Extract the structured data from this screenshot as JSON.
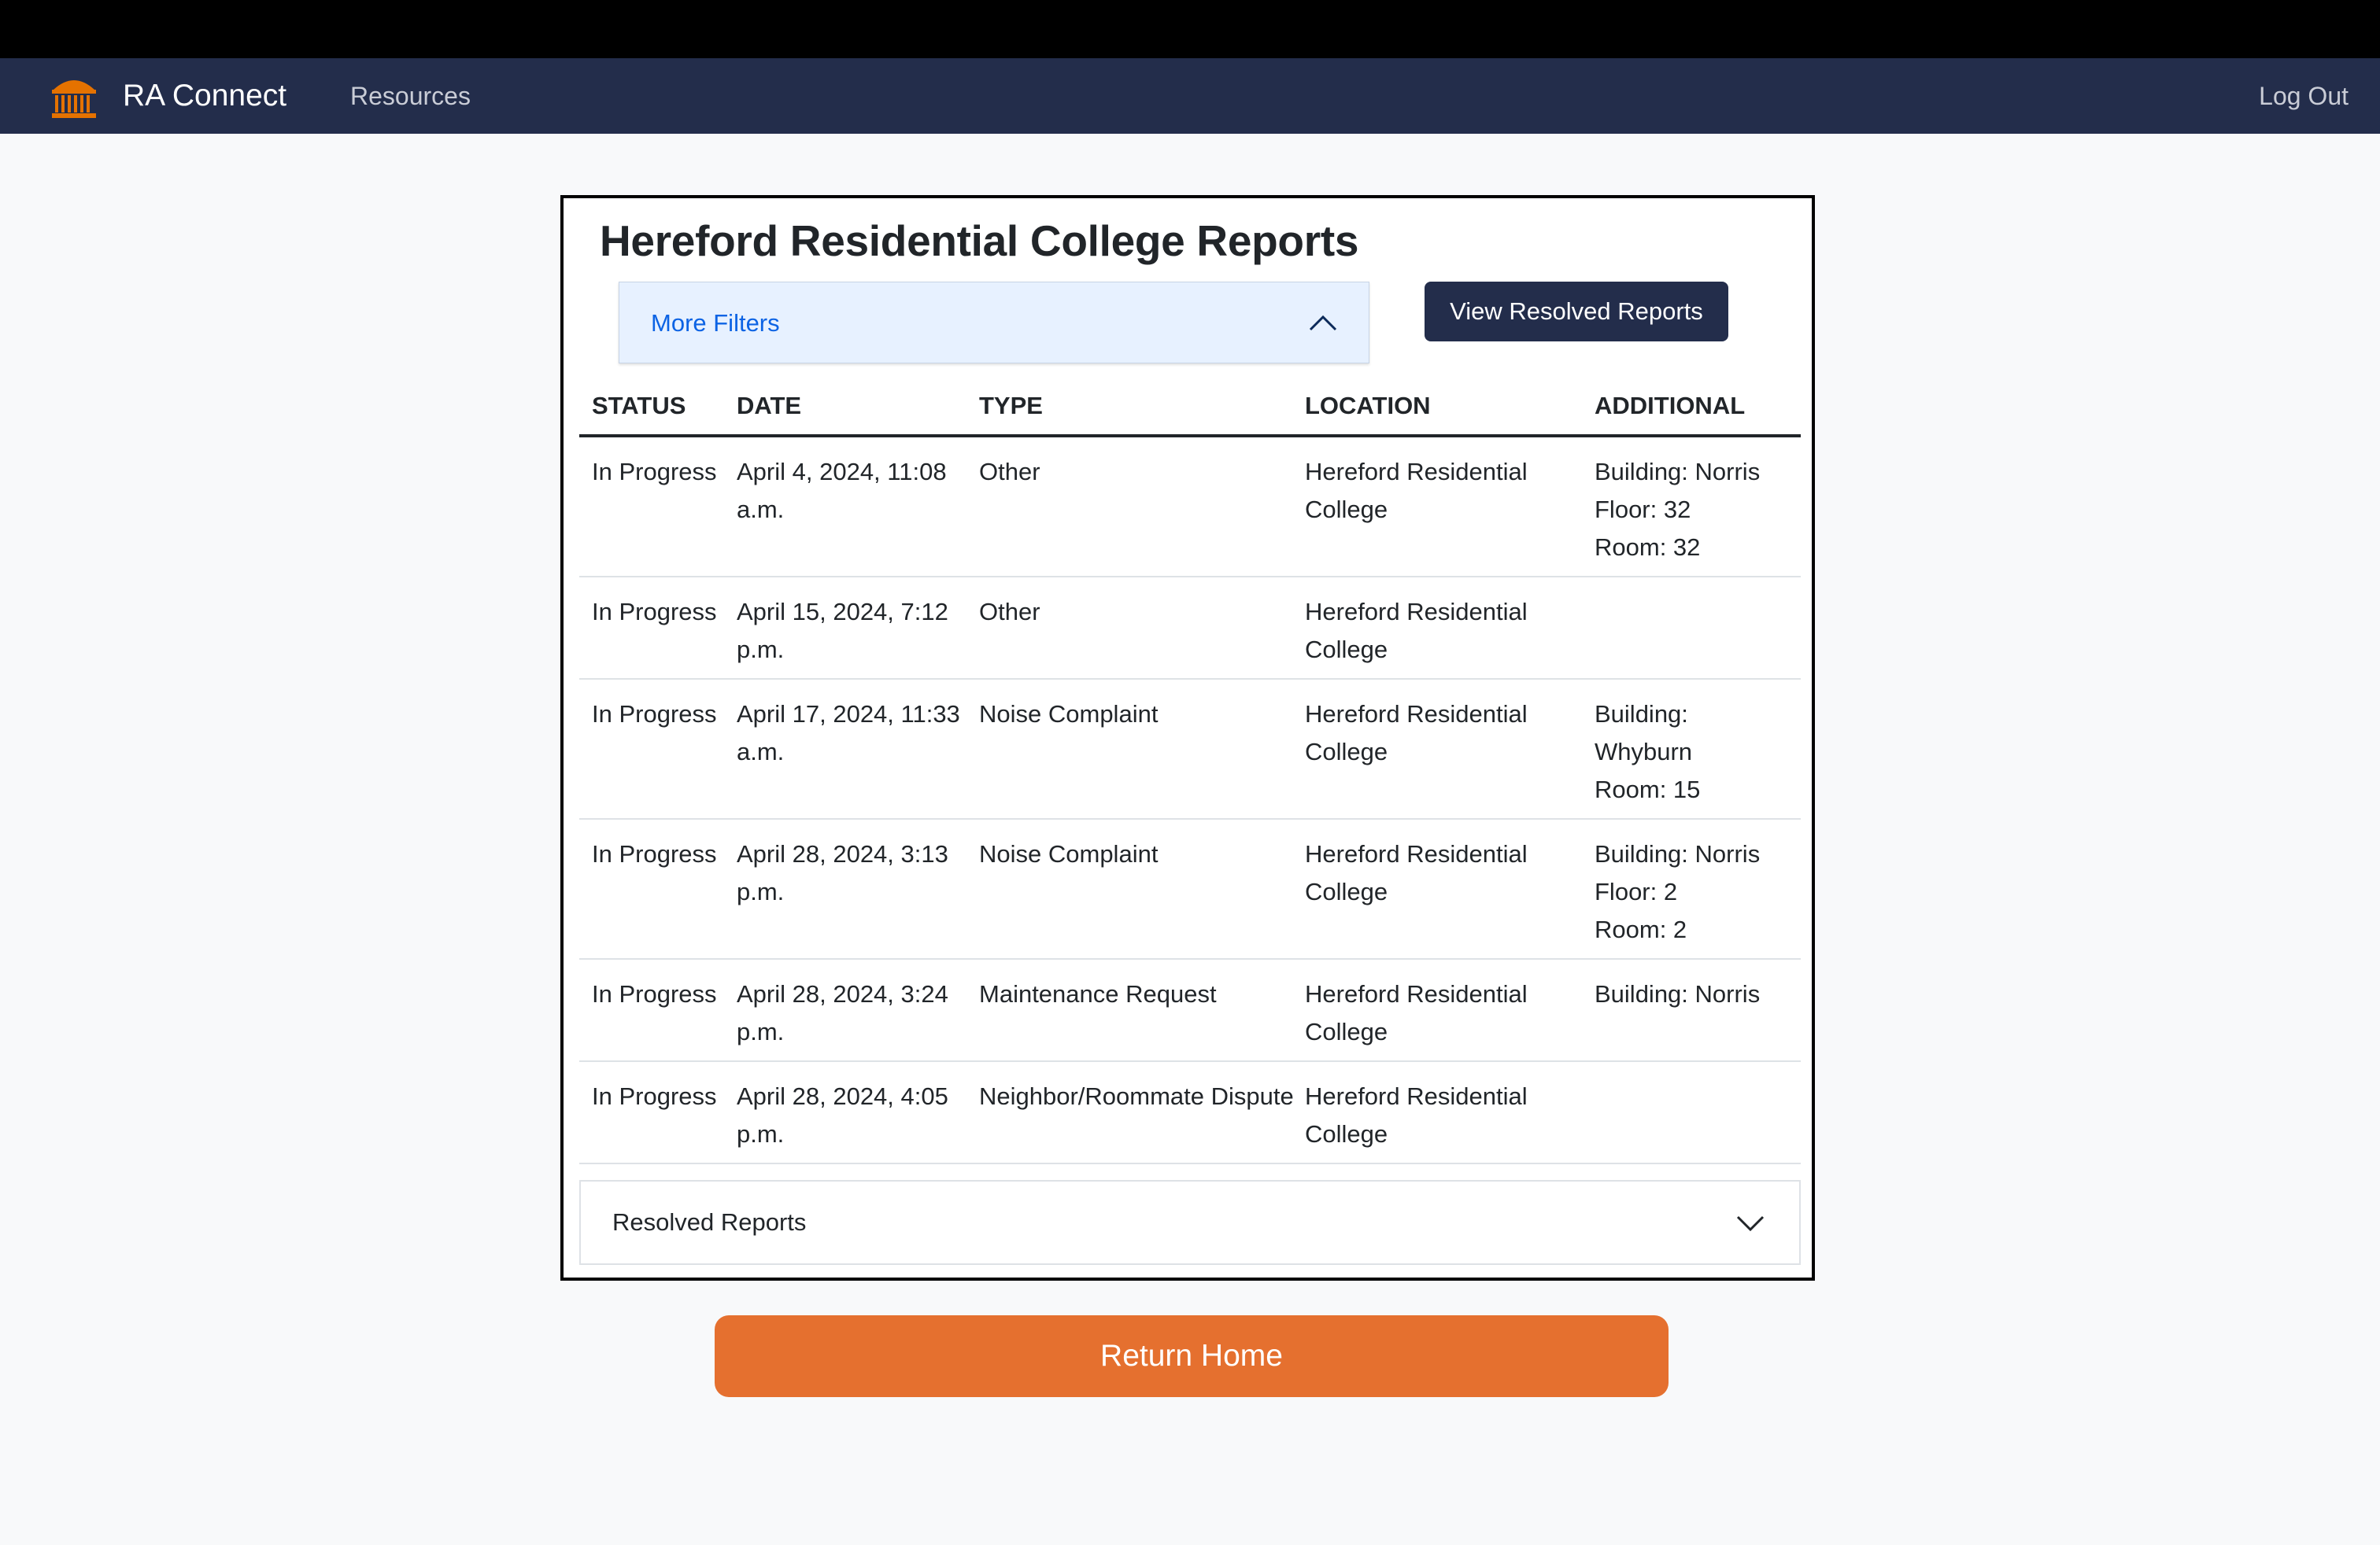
{
  "nav": {
    "brand": "RA Connect",
    "links": [
      "Resources"
    ],
    "logout": "Log Out",
    "brand_color": "#e57200",
    "bar_color": "#232d4b"
  },
  "reports": {
    "title": "Hereford Residential College Reports",
    "filters_label": "More Filters",
    "view_resolved_label": "View Resolved Reports",
    "columns": [
      "STATUS",
      "DATE",
      "TYPE",
      "LOCATION",
      "ADDITIONAL"
    ],
    "rows": [
      {
        "status": "In Progress",
        "date": "April 4, 2024, 11:08 a.m.",
        "type": "Other",
        "location": "Hereford Residential College",
        "additional": [
          "Building: Norris",
          "Floor: 32",
          "Room: 32"
        ]
      },
      {
        "status": "In Progress",
        "date": "April 15, 2024, 7:12 p.m.",
        "type": "Other",
        "location": "Hereford Residential College",
        "additional": []
      },
      {
        "status": "In Progress",
        "date": "April 17, 2024, 11:33 a.m.",
        "type": "Noise Complaint",
        "location": "Hereford Residential College",
        "additional": [
          "Building: Whyburn",
          "Room: 15"
        ]
      },
      {
        "status": "In Progress",
        "date": "April 28, 2024, 3:13 p.m.",
        "type": "Noise Complaint",
        "location": "Hereford Residential College",
        "additional": [
          "Building: Norris",
          "Floor: 2",
          "Room: 2"
        ]
      },
      {
        "status": "In Progress",
        "date": "April 28, 2024, 3:24 p.m.",
        "type": "Maintenance Request",
        "location": "Hereford Residential College",
        "additional": [
          "Building: Norris"
        ]
      },
      {
        "status": "In Progress",
        "date": "April 28, 2024, 4:05 p.m.",
        "type": "Neighbor/Roommate Dispute",
        "location": "Hereford Residential College",
        "additional": []
      }
    ],
    "resolved_accordion_label": "Resolved Reports"
  },
  "return_home_label": "Return Home"
}
